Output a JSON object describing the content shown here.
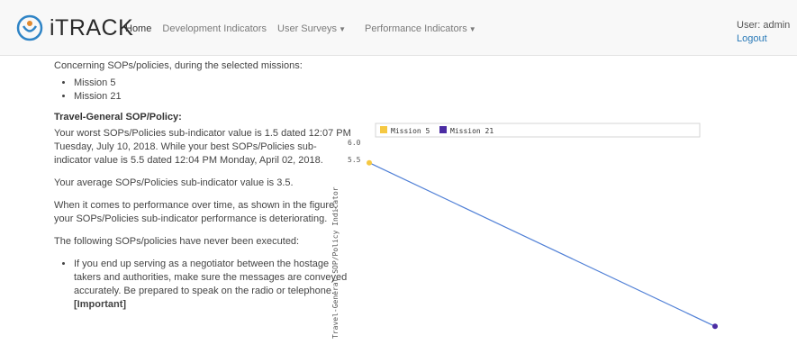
{
  "app": {
    "title": "iTRACK",
    "nav": {
      "home": "Home",
      "development": "Development Indicators",
      "surveys": "User Surveys",
      "performance": "Performance Indicators"
    },
    "user_label": "User: admin",
    "logout": "Logout"
  },
  "content": {
    "intro": "Concerning SOPs/policies, during the selected missions:",
    "missions": [
      "Mission 5",
      "Mission 21"
    ],
    "section_title": "Travel-General SOP/Policy:",
    "worst_best": "Your worst SOPs/Policies sub-indicator value is 1.5 dated 12:07 PM Tuesday, July 10, 2018. While your best SOPs/Policies sub-indicator value is 5.5 dated 12:04 PM Monday, April 02, 2018.",
    "average": "Your average SOPs/Policies sub-indicator value is 3.5.",
    "trend": "When it comes to performance over time, as shown in the figure, your SOPs/Policies sub-indicator performance is deteriorating.",
    "never_executed_intro": "The following SOPs/policies have never been executed:",
    "never_items": [
      {
        "text": "If you end up serving as a negotiator between the hostage takers and authorities, make sure the messages are conveyed accurately. Be prepared to speak on the radio or telephone. ",
        "tag": "Important"
      }
    ]
  },
  "chart_data": {
    "type": "line",
    "ylabel": "Travel-General SOP/Policy Indicator",
    "yticks": [
      "6.0",
      "5.5"
    ],
    "ylim": [
      1.0,
      6.0
    ],
    "series": [
      {
        "name": "Mission 5",
        "color": "#f5c842",
        "x": [
          0
        ],
        "y": [
          5.5
        ]
      },
      {
        "name": "Mission 21",
        "color": "#4b2ca3",
        "x": [
          1
        ],
        "y": [
          1.5
        ]
      }
    ],
    "connector": {
      "x": [
        0,
        1
      ],
      "y": [
        5.5,
        1.5
      ],
      "color": "#4f7fd6"
    },
    "legend": "top"
  }
}
